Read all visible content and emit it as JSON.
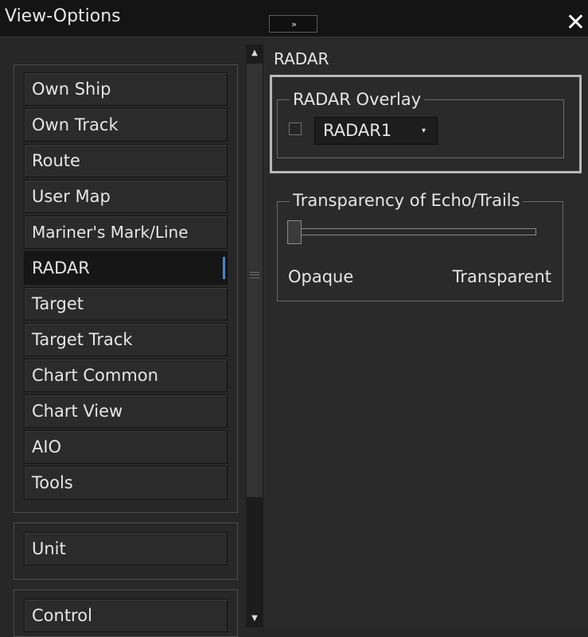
{
  "window": {
    "title": "View-Options",
    "expand_label": "››",
    "close_label": "✕"
  },
  "nav": {
    "main_items": [
      {
        "label": "Own Ship"
      },
      {
        "label": "Own Track"
      },
      {
        "label": "Route"
      },
      {
        "label": "User Map"
      },
      {
        "label": "Mariner's Mark/Line"
      },
      {
        "label": "RADAR",
        "selected": true
      },
      {
        "label": "Target"
      },
      {
        "label": "Target Track"
      },
      {
        "label": "Chart Common"
      },
      {
        "label": "Chart View"
      },
      {
        "label": "AIO"
      },
      {
        "label": "Tools"
      }
    ],
    "unit_item": {
      "label": "Unit"
    },
    "control_item": {
      "label": "Control"
    },
    "selected_color": "#4a86c8"
  },
  "scrollbar": {
    "up_icon": "▲",
    "down_icon": "▼"
  },
  "panel": {
    "heading": "RADAR",
    "overlay": {
      "legend": "RADAR Overlay",
      "checked": false,
      "selected_value": "RADAR1",
      "dropdown_icon": "▾"
    },
    "transparency": {
      "legend": "Transparency of Echo/Trails",
      "value_fraction": 0.0,
      "min_label": "Opaque",
      "max_label": "Transparent"
    }
  }
}
